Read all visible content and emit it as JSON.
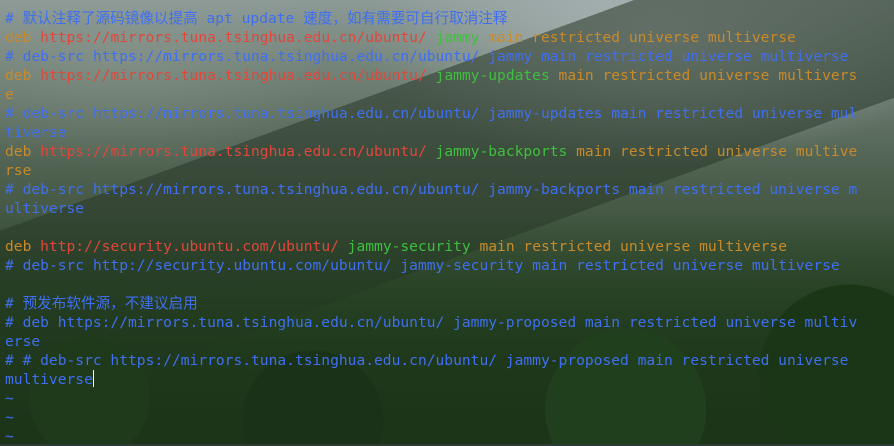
{
  "terminal": {
    "lines": [
      {
        "segments": [
          {
            "text": "# 默认注释了源码镜像以提高 apt update 速度，如有需要可自行取消注释",
            "color": "blue"
          }
        ]
      },
      {
        "segments": [
          {
            "text": "deb ",
            "color": "orange"
          },
          {
            "text": "https://mirrors.tuna.tsinghua.edu.cn/ubuntu/",
            "color": "red"
          },
          {
            "text": " jammy",
            "color": "green"
          },
          {
            "text": " main restricted universe multiverse",
            "color": "orange"
          }
        ]
      },
      {
        "segments": [
          {
            "text": "# deb-src https://mirrors.tuna.tsinghua.edu.cn/ubuntu/ jammy main restricted universe multiverse",
            "color": "blue"
          }
        ]
      },
      {
        "segments": [
          {
            "text": "deb ",
            "color": "orange"
          },
          {
            "text": "https://mirrors.tuna.tsinghua.edu.cn/ubuntu/",
            "color": "red"
          },
          {
            "text": " jammy-updates",
            "color": "green"
          },
          {
            "text": " main restricted universe multivers",
            "color": "orange"
          }
        ]
      },
      {
        "segments": [
          {
            "text": "e",
            "color": "orange"
          }
        ]
      },
      {
        "segments": [
          {
            "text": "# deb-src https://mirrors.tuna.tsinghua.edu.cn/ubuntu/ jammy-updates main restricted universe mul",
            "color": "blue"
          }
        ]
      },
      {
        "segments": [
          {
            "text": "tiverse",
            "color": "blue"
          }
        ]
      },
      {
        "segments": [
          {
            "text": "deb ",
            "color": "orange"
          },
          {
            "text": "https://mirrors.tuna.tsinghua.edu.cn/ubuntu/",
            "color": "red"
          },
          {
            "text": " jammy-backports",
            "color": "green"
          },
          {
            "text": " main restricted universe multive",
            "color": "orange"
          }
        ]
      },
      {
        "segments": [
          {
            "text": "rse",
            "color": "orange"
          }
        ]
      },
      {
        "segments": [
          {
            "text": "# deb-src https://mirrors.tuna.tsinghua.edu.cn/ubuntu/ jammy-backports main restricted universe m",
            "color": "blue"
          }
        ]
      },
      {
        "segments": [
          {
            "text": "ultiverse",
            "color": "blue"
          }
        ]
      },
      {
        "segments": [
          {
            "text": "",
            "color": "blue"
          }
        ]
      },
      {
        "segments": [
          {
            "text": "deb ",
            "color": "orange"
          },
          {
            "text": "http://security.ubuntu.com/ubuntu/",
            "color": "red"
          },
          {
            "text": " jammy-security",
            "color": "green"
          },
          {
            "text": " main restricted universe multiverse",
            "color": "orange"
          }
        ]
      },
      {
        "segments": [
          {
            "text": "# deb-src http://security.ubuntu.com/ubuntu/ jammy-security main restricted universe multiverse",
            "color": "blue"
          }
        ]
      },
      {
        "segments": [
          {
            "text": "",
            "color": "blue"
          }
        ]
      },
      {
        "segments": [
          {
            "text": "# 预发布软件源，不建议启用",
            "color": "blue"
          }
        ]
      },
      {
        "segments": [
          {
            "text": "# deb https://mirrors.tuna.tsinghua.edu.cn/ubuntu/ jammy-proposed main restricted universe multiv",
            "color": "blue"
          }
        ]
      },
      {
        "segments": [
          {
            "text": "erse",
            "color": "blue"
          }
        ]
      },
      {
        "segments": [
          {
            "text": "# # deb-src https://mirrors.tuna.tsinghua.edu.cn/ubuntu/ jammy-proposed main restricted universe",
            "color": "blue"
          }
        ]
      },
      {
        "segments": [
          {
            "text": "multiverse",
            "color": "blue"
          }
        ],
        "cursor": true
      },
      {
        "segments": [
          {
            "text": "~",
            "color": "blue"
          }
        ]
      },
      {
        "segments": [
          {
            "text": "~",
            "color": "blue"
          }
        ]
      },
      {
        "segments": [
          {
            "text": "~",
            "color": "blue"
          }
        ]
      }
    ]
  },
  "colors": {
    "blue": "#3f6ff0",
    "orange": "#c88a2a",
    "red": "#e0473b",
    "green": "#3fbf3f"
  }
}
